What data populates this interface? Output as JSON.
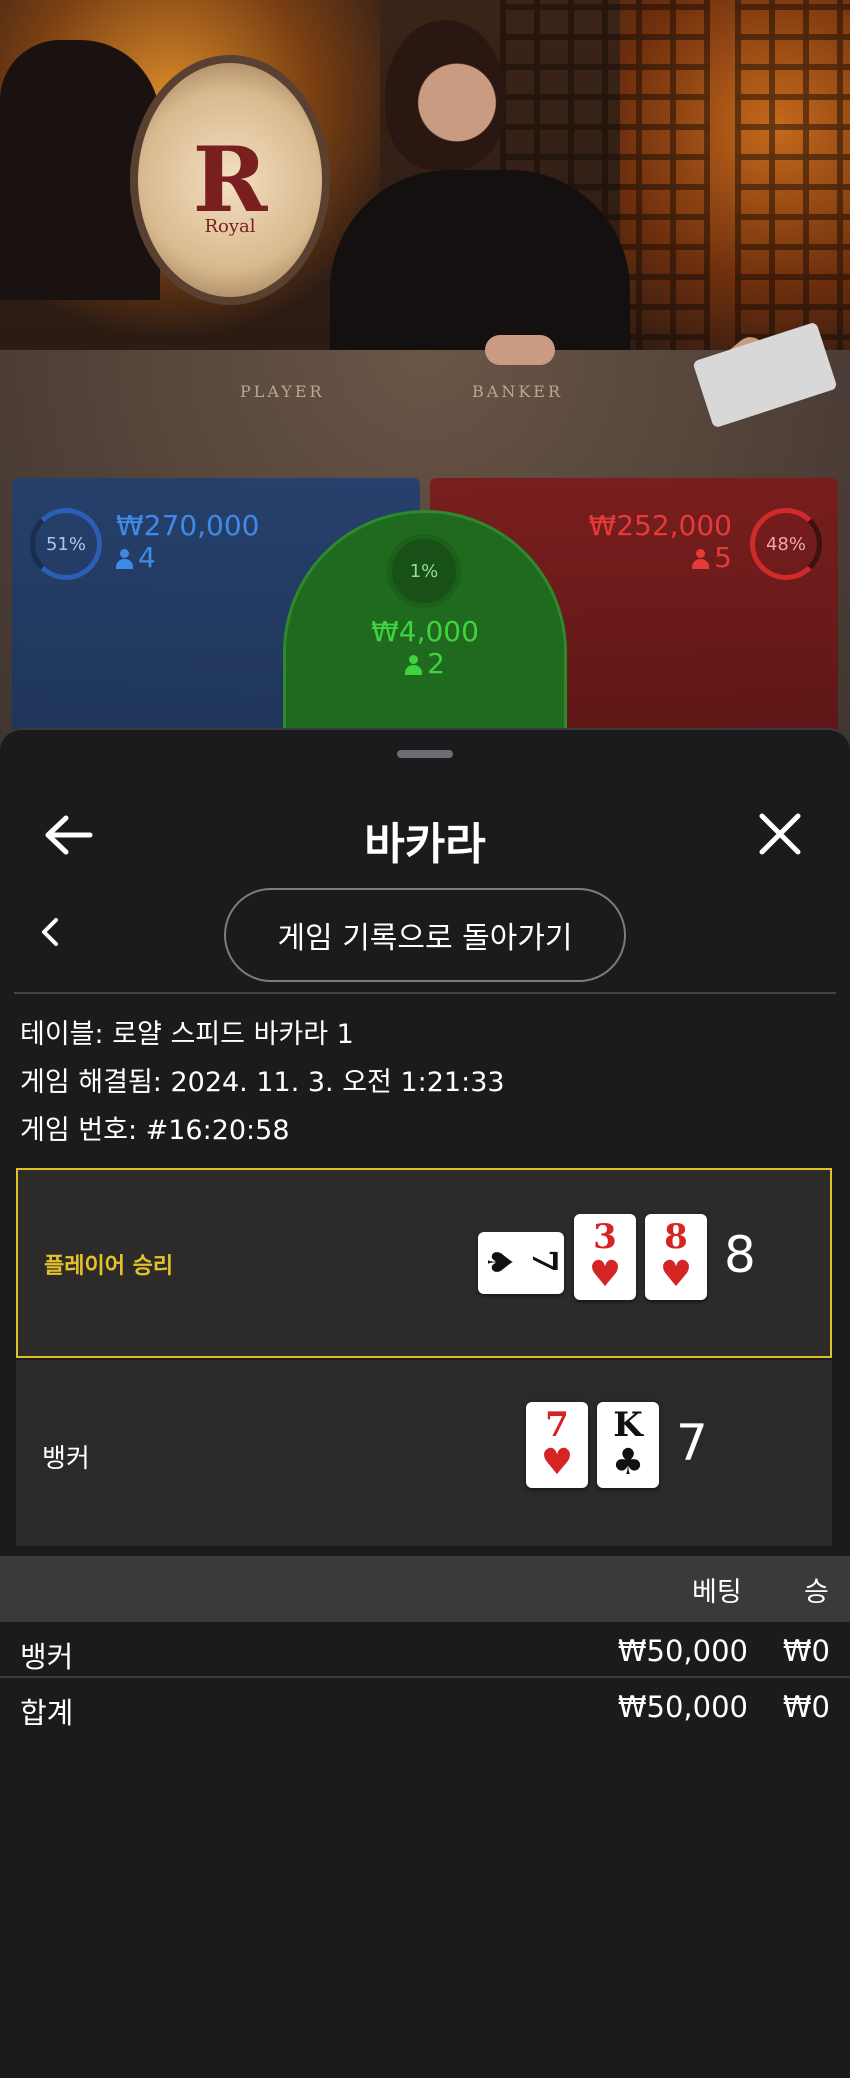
{
  "video": {
    "table_labels": {
      "player": "PLAYER",
      "banker": "BANKER"
    },
    "emblem": {
      "letter": "R",
      "word": "Royal"
    }
  },
  "bet_spots": {
    "player": {
      "percent": "51%",
      "amount": "₩270,000",
      "players": "4",
      "color": "#2a5fb3"
    },
    "banker": {
      "percent": "48%",
      "amount": "₩252,000",
      "players": "5",
      "color": "#d12a2a"
    },
    "tie": {
      "percent": "1%",
      "amount": "₩4,000",
      "players": "2",
      "color": "#3fd33f"
    }
  },
  "sheet": {
    "title": "바카라",
    "back_icon": "arrow-left-icon",
    "close_icon": "close-icon",
    "history_button": "게임 기록으로 돌아가기",
    "table_info": "테이블: 로얄 스피드 바카라 1",
    "resolved_info": "게임 해결됨: 2024. 11. 3. 오전 1:21:33",
    "game_number": "게임 번호: #16:20:58"
  },
  "results": {
    "player": {
      "label": "플레이어 승리",
      "score": "8",
      "cards": [
        {
          "rank": "7",
          "suit": "♠",
          "color": "black",
          "sideways": true
        },
        {
          "rank": "3",
          "suit": "♥",
          "color": "red"
        },
        {
          "rank": "8",
          "suit": "♥",
          "color": "red"
        }
      ],
      "highlight_color": "#e0c02a"
    },
    "banker": {
      "label": "뱅커",
      "score": "7",
      "cards": [
        {
          "rank": "7",
          "suit": "♥",
          "color": "red"
        },
        {
          "rank": "K",
          "suit": "♣",
          "color": "black"
        }
      ]
    }
  },
  "bets": {
    "headers": {
      "bet": "베팅",
      "win": "승"
    },
    "rows": [
      {
        "name": "뱅커",
        "bet": "₩50,000",
        "win": "₩0"
      },
      {
        "name": "합계",
        "bet": "₩50,000",
        "win": "₩0"
      }
    ]
  }
}
